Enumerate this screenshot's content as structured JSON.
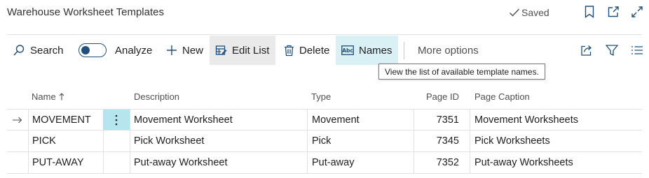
{
  "page": {
    "title": "Warehouse Worksheet Templates",
    "saved_status": "Saved"
  },
  "toolbar": {
    "search": "Search",
    "analyze": "Analyze",
    "new": "New",
    "edit_list": "Edit List",
    "delete": "Delete",
    "names": "Names",
    "more_options": "More options"
  },
  "tooltip": {
    "text": "View the list of available template names."
  },
  "columns": {
    "name": "Name",
    "description": "Description",
    "type": "Type",
    "page_id": "Page ID",
    "page_caption": "Page Caption"
  },
  "rows": [
    {
      "name": "MOVEMENT",
      "description": "Movement Worksheet",
      "type": "Movement",
      "page_id": "7351",
      "page_caption": "Movement Worksheets"
    },
    {
      "name": "PICK",
      "description": "Pick Worksheet",
      "type": "Pick",
      "page_id": "7345",
      "page_caption": "Pick Worksheets"
    },
    {
      "name": "PUT-AWAY",
      "description": "Put-away Worksheet",
      "type": "Put-away",
      "page_id": "7352",
      "page_caption": "Put-away Worksheets"
    }
  ],
  "colors": {
    "accent": "#1f4f7a",
    "selected_cell": "#b5e6ef",
    "names_highlight": "#d9f0f4"
  },
  "icons": {
    "saved": "checkmark-icon",
    "bookmark": "bookmark-icon",
    "open_new": "open-in-new-window-icon",
    "expand": "expand-icon",
    "search": "search-icon",
    "new": "plus-icon",
    "edit_list": "edit-list-icon",
    "delete": "trash-icon",
    "names": "abc-icon",
    "share": "share-icon",
    "filter": "filter-icon",
    "list": "list-view-icon",
    "row_arrow": "arrow-right-icon",
    "row_actions": "more-vertical-icon"
  }
}
